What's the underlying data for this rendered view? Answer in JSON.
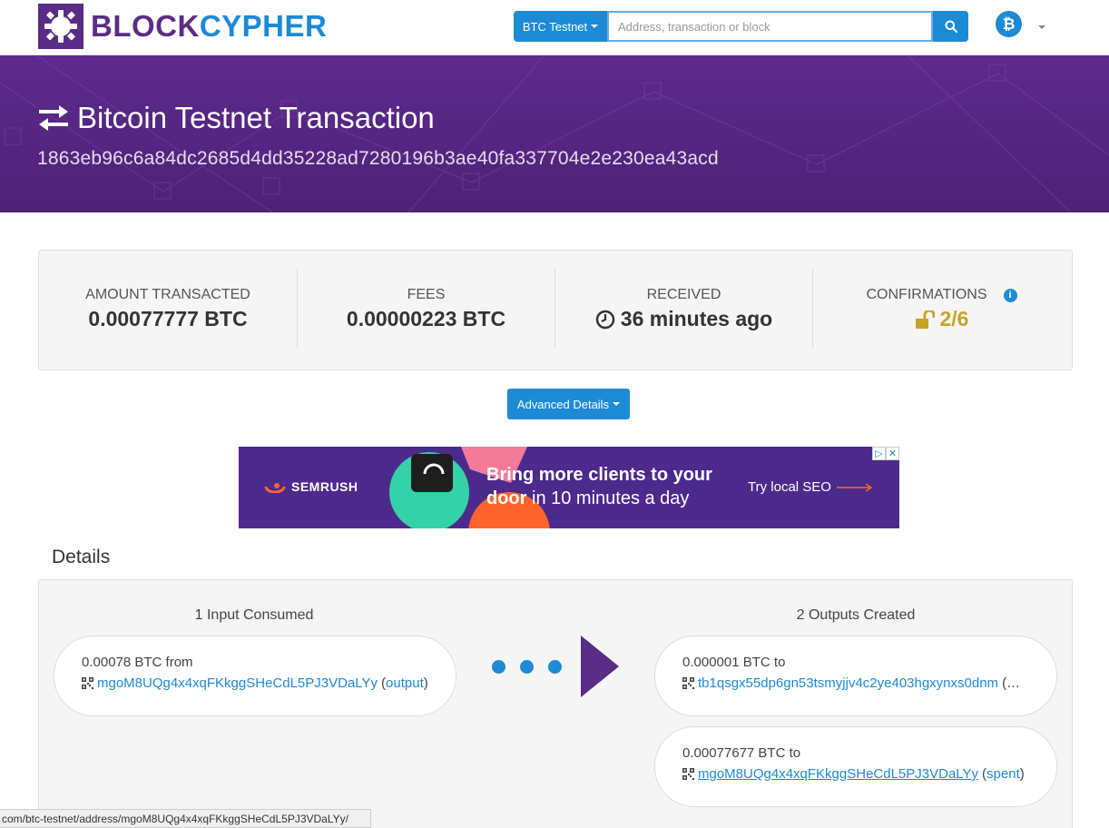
{
  "nav": {
    "logo_a": "BLOCK",
    "logo_b": "CYPHER",
    "network_label": "BTC Testnet",
    "search_placeholder": "Address, transaction or block",
    "currency_icon": "bitcoin-icon"
  },
  "hero": {
    "title": "Bitcoin Testnet Transaction",
    "hash": "1863eb96c6a84dc2685d4dd35228ad7280196b3ae40fa337704e2e230ea43acd"
  },
  "summary": {
    "amount_label": "AMOUNT TRANSACTED",
    "amount_value": "0.00077777 BTC",
    "fees_label": "FEES",
    "fees_value": "0.00000223 BTC",
    "received_label": "RECEIVED",
    "received_value": "36 minutes ago",
    "confirmations_label": "CONFIRMATIONS",
    "confirmations_value": "2/6",
    "colors": {
      "confirmations": "#c9a227",
      "accent": "#1d8ad6",
      "brand": "#5b2c86"
    }
  },
  "advanced_button": "Advanced Details",
  "ad": {
    "brand": "SEMRUSH",
    "headline_bold": "Bring more clients to your door",
    "headline_rest": " in 10 minutes a day",
    "cta": "Try local SEO"
  },
  "details": {
    "title": "Details",
    "inputs_heading": "1 Input Consumed",
    "outputs_heading": "2 Outputs Created",
    "inputs": [
      {
        "amount": "0.00078 BTC from",
        "address": "mgoM8UQg4x4xqFKkggSHeCdL5PJ3VDaLYy",
        "open": "(",
        "tag": "output",
        "close": ")"
      }
    ],
    "outputs": [
      {
        "amount": "0.000001 BTC to",
        "address": "tb1qsgx55dp6gn53tsmyjjv4c2ye403hgxynxs0dnm",
        "open": "(…",
        "tag": "",
        "close": ""
      },
      {
        "amount": "0.00077677 BTC to",
        "address": "mgoM8UQg4x4xqFKkggSHeCdL5PJ3VDaLYy",
        "open": "(",
        "tag": "spent",
        "close": ")"
      }
    ]
  },
  "statusbar": "com/btc-testnet/address/mgoM8UQg4x4xqFKkggSHeCdL5PJ3VDaLYy/"
}
